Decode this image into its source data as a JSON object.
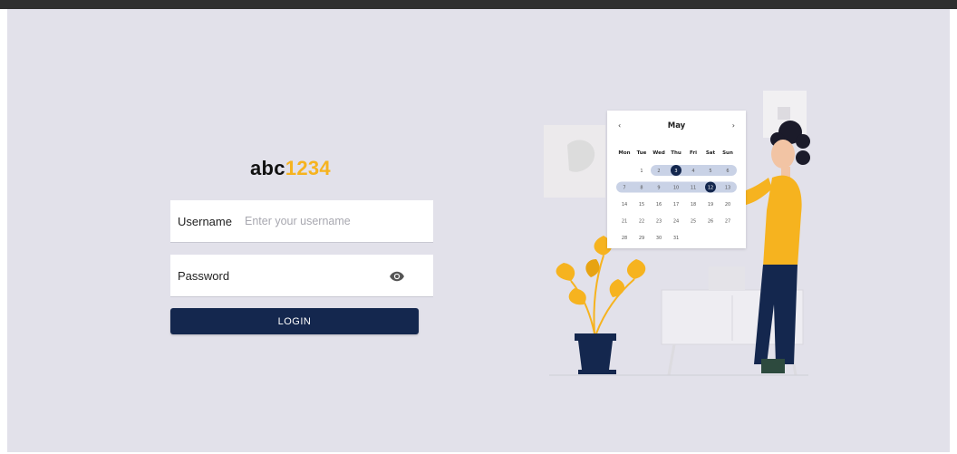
{
  "brand": {
    "prefix": "abc",
    "suffix": "1234",
    "accent_color": "#f6b31f"
  },
  "form": {
    "username": {
      "label": "Username",
      "placeholder": "Enter your username",
      "value": ""
    },
    "password": {
      "label": "Password",
      "value": "",
      "toggle_icon": "eye-icon"
    },
    "login_button": "LOGIN"
  },
  "calendar": {
    "month": "May",
    "weekdays": [
      "Mon",
      "Tue",
      "Wed",
      "Thu",
      "Fri",
      "Sat",
      "Sun"
    ],
    "weeks": [
      [
        "",
        "1",
        "2",
        "3",
        "4",
        "5",
        "6"
      ],
      [
        "7",
        "8",
        "9",
        "10",
        "11",
        "12",
        "13"
      ],
      [
        "14",
        "15",
        "16",
        "17",
        "18",
        "19",
        "20"
      ],
      [
        "21",
        "22",
        "23",
        "24",
        "25",
        "26",
        "27"
      ],
      [
        "28",
        "29",
        "30",
        "31",
        "",
        "",
        ""
      ]
    ],
    "highlighted": [
      "3",
      "12"
    ]
  },
  "colors": {
    "primary": "#14274e",
    "background": "#e2e1ea",
    "accent": "#f6b31f"
  }
}
